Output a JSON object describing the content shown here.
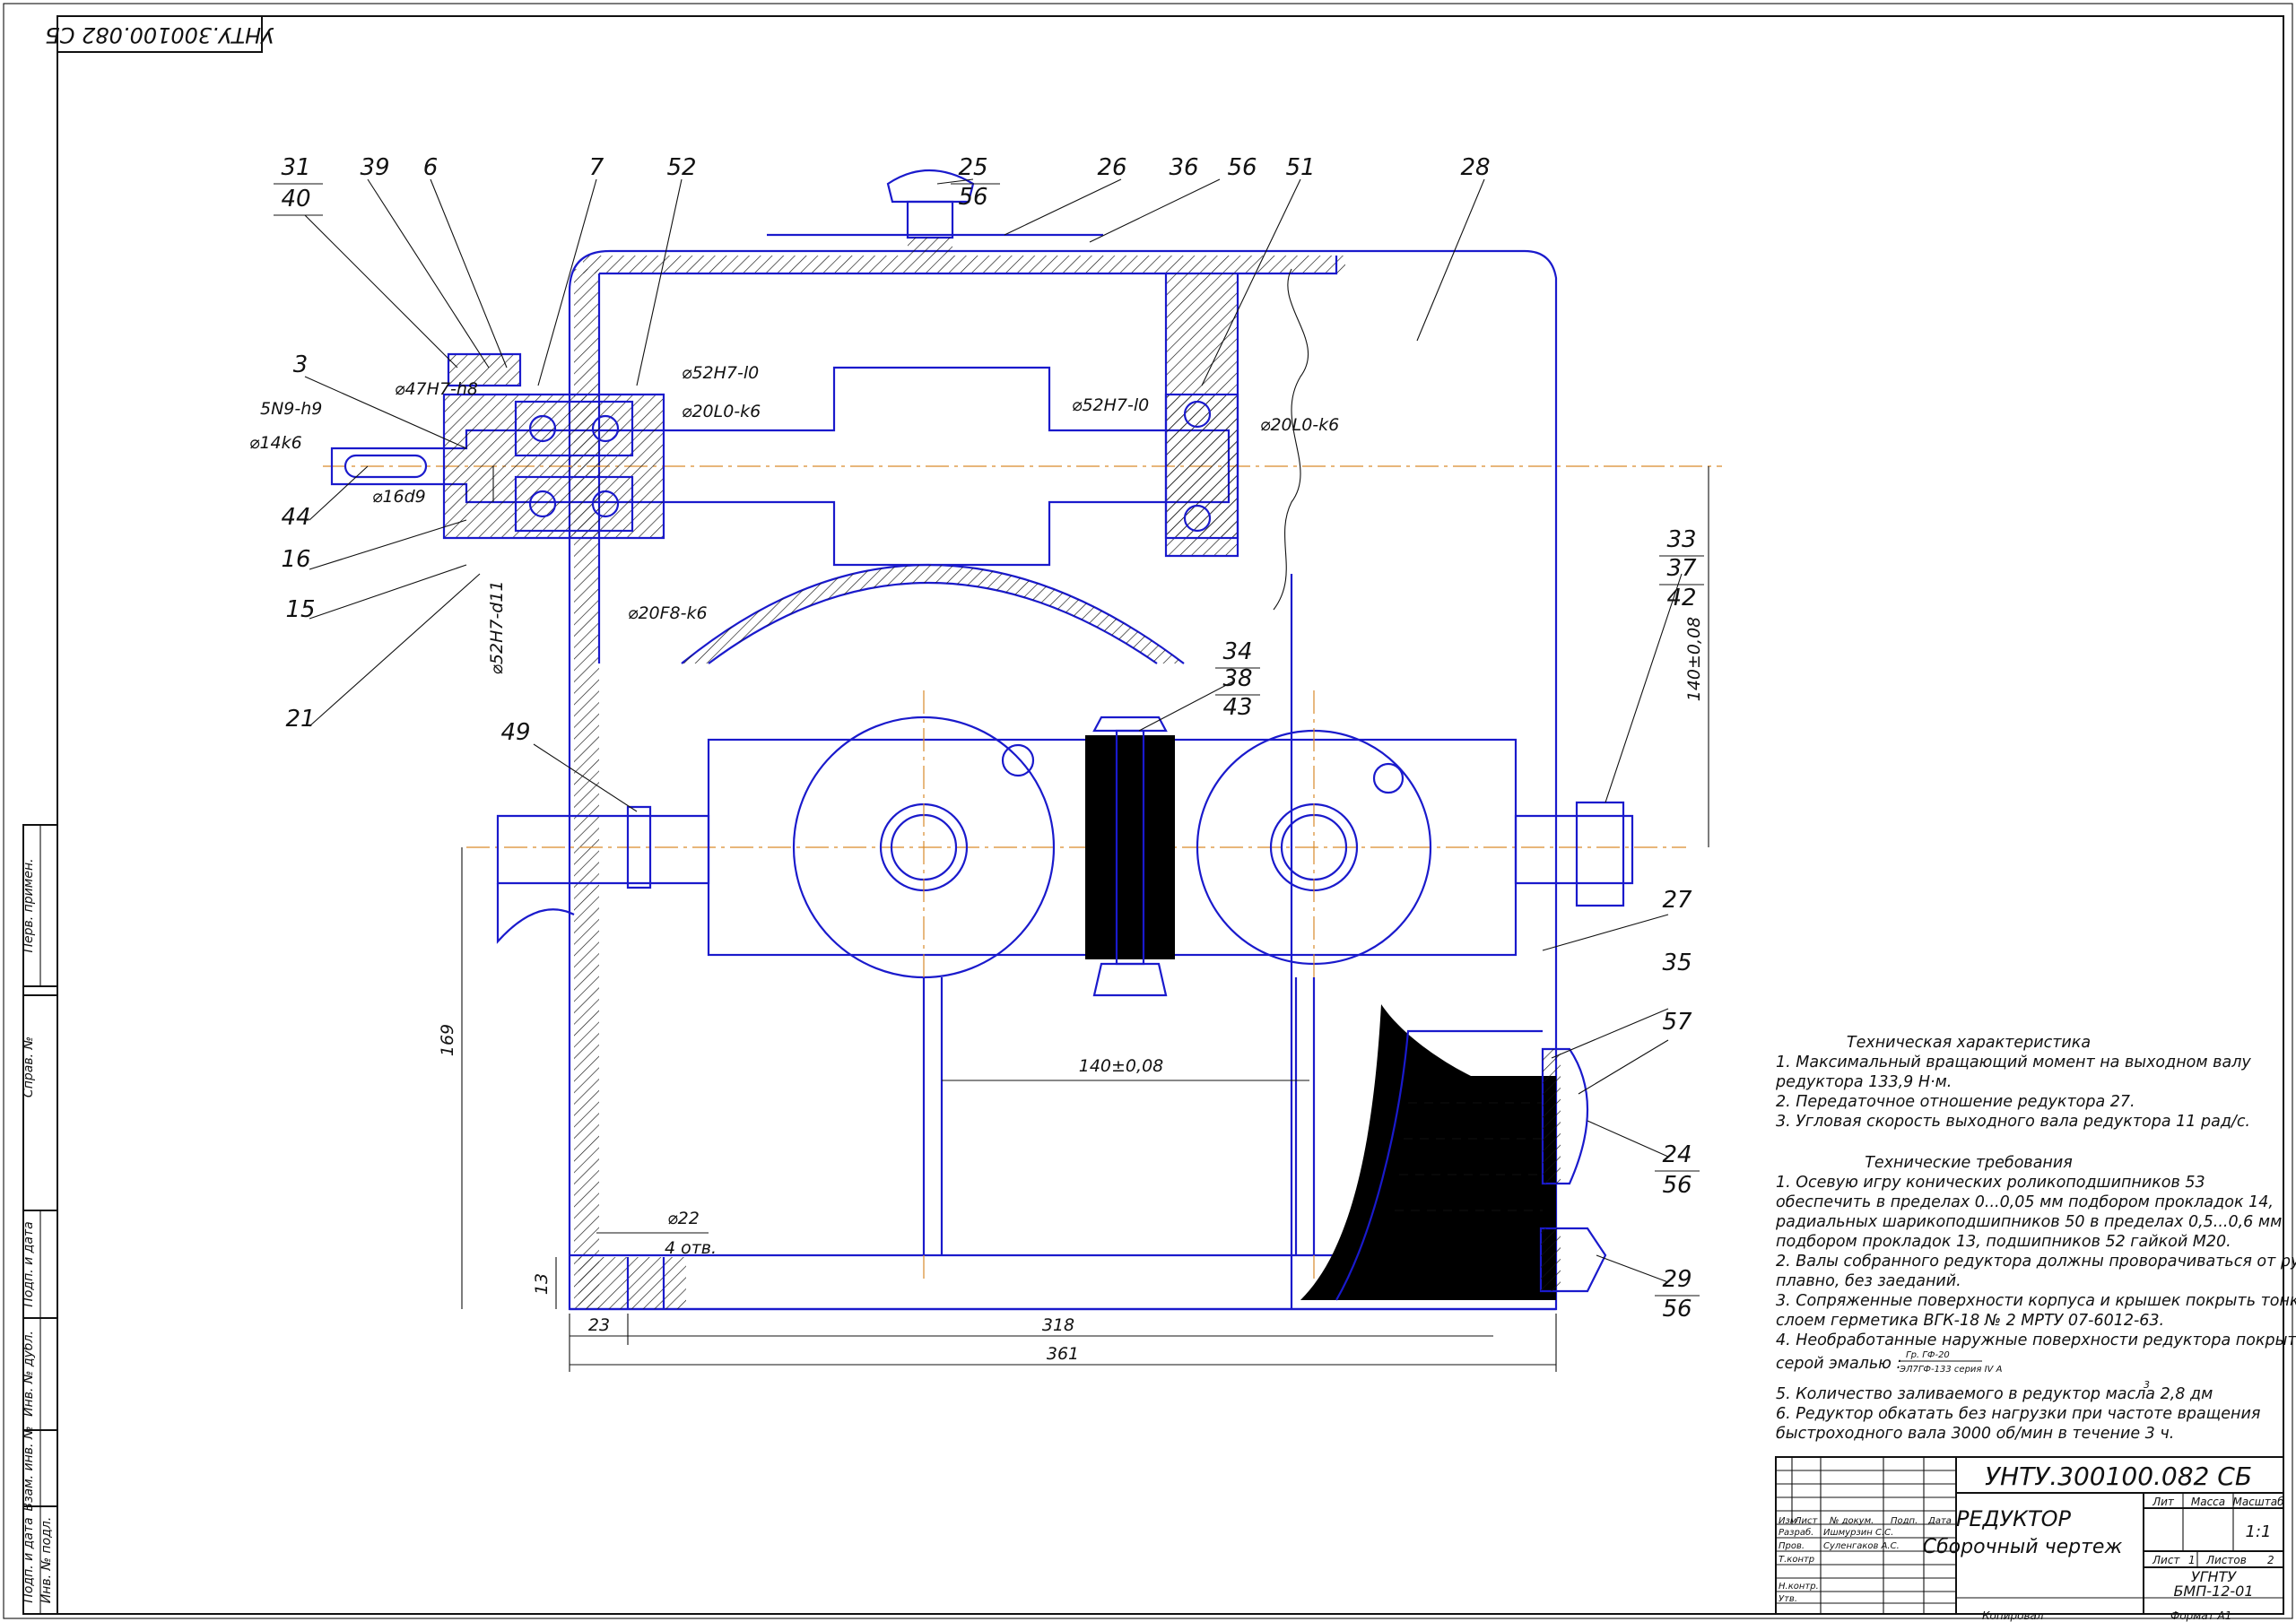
{
  "drawing": {
    "code_rotated": "УНТУ.300100.082 СБ",
    "stamp_columns": [
      "Перв. примен.",
      "Справ. №",
      "Подп. и дата",
      "Инв. № дубл.",
      "Взам. инв. №",
      "Подп. и дата",
      "Инв. № подл."
    ]
  },
  "callouts": [
    {
      "label": "31"
    },
    {
      "label": "40"
    },
    {
      "label": "39"
    },
    {
      "label": "6"
    },
    {
      "label": "7"
    },
    {
      "label": "52"
    },
    {
      "label": "25"
    },
    {
      "label": "56"
    },
    {
      "label": "26"
    },
    {
      "label": "36"
    },
    {
      "label": "56"
    },
    {
      "label": "51"
    },
    {
      "label": "28"
    },
    {
      "label": "3"
    },
    {
      "label": "44"
    },
    {
      "label": "16"
    },
    {
      "label": "15"
    },
    {
      "label": "21"
    },
    {
      "label": "49"
    },
    {
      "label": "34"
    },
    {
      "label": "38"
    },
    {
      "label": "43"
    },
    {
      "label": "33"
    },
    {
      "label": "37"
    },
    {
      "label": "42"
    },
    {
      "label": "27"
    },
    {
      "label": "35"
    },
    {
      "label": "57"
    },
    {
      "label": "24"
    },
    {
      "label": "56"
    },
    {
      "label": "29"
    },
    {
      "label": "56"
    }
  ],
  "dimensions": {
    "d47": "⌀47H7-h8",
    "key": "5N9-h9",
    "d14": "⌀14k6",
    "d16": "⌀16d9",
    "d52a": "⌀52H7-l0",
    "d20a": "⌀20L0-k6",
    "d20f": "⌀20F8-k6",
    "d52d": "⌀52H7-d11",
    "d52b": "⌀52H7-l0",
    "d20b": "⌀20L0-k6",
    "c140v": "140±0,08",
    "c140h": "140±0,08",
    "h169": "169",
    "d22": "⌀22",
    "holes": "4 отв.",
    "h13": "13",
    "w23": "23",
    "w318": "318",
    "w361": "361"
  },
  "tech_characteristics": {
    "title": "Техническая характеристика",
    "lines": [
      "1. Максимальный вращающий момент  на выходном валу",
      "    редуктора 133,9 Н·м.",
      "2. Передаточное отношение редуктора 27.",
      "3. Угловая скорость выходного вала редуктора 11 рад/с."
    ]
  },
  "tech_requirements": {
    "title": "Технические требования",
    "lines": [
      "1. Осевую игру конических роликоподшипников 53",
      "обеспечить в пределах 0...0,05 мм подбором прокладок 14,",
      "радиальных шарикоподшипников 50 в пределах 0,5...0,6 мм",
      "подбором прокладок 13, подшипников 52 гайкой М20.",
      "2. Валы собранного редуктора должны проворачиваться от руки",
      "    плавно, без заеданий.",
      "3. Сопряженные поверхности корпуса и крышек покрыть тонким",
      "    слоем герметика ВГК-18 № 2 МРТУ 07-6012-63.",
      "4. Необработанные наружные поверхности редуктора покрыть",
      "    серой эмалью :",
      "5. Количество заливаемого в редуктор масла 2,8 дм",
      "6. Редуктор обкатать без нагрузки при частоте вращения",
      "    быстроходного вала 3000 об/мин в течение 3 ч."
    ],
    "enamel_top": "Гр. ГФ-20",
    "enamel_bottom": "ЭЛ7ГФ-133 серия IV А",
    "sup3": "3"
  },
  "title_block": {
    "designation": "УНТУ.300100.082 СБ",
    "name1": "РЕДУКТОР",
    "name2": "Сборочный чертеж",
    "lit": "Лит",
    "mass": "Масса",
    "scale_h": "Масштаб",
    "scale": "1:1",
    "sheet_label": "Лист",
    "sheet": "1",
    "sheets_label": "Листов",
    "sheets": "2",
    "org1": "УГНТУ",
    "org2": "БМП-12-01",
    "h_izm": "Изм",
    "h_list": "Лист",
    "h_doc": "№ докум.",
    "h_podp": "Подп.",
    "h_date": "Дата",
    "r_razrab": "Разраб.",
    "razrab_name": "Ишмурзин С.С.",
    "r_prov": "Пров.",
    "prov_name": "Суленгаков А.С.",
    "r_tkontr": "Т.контр",
    "r_nkontr": "Н.контр.",
    "r_utv": "Утв.",
    "copied": "Копировал",
    "format": "Формат    А1"
  }
}
